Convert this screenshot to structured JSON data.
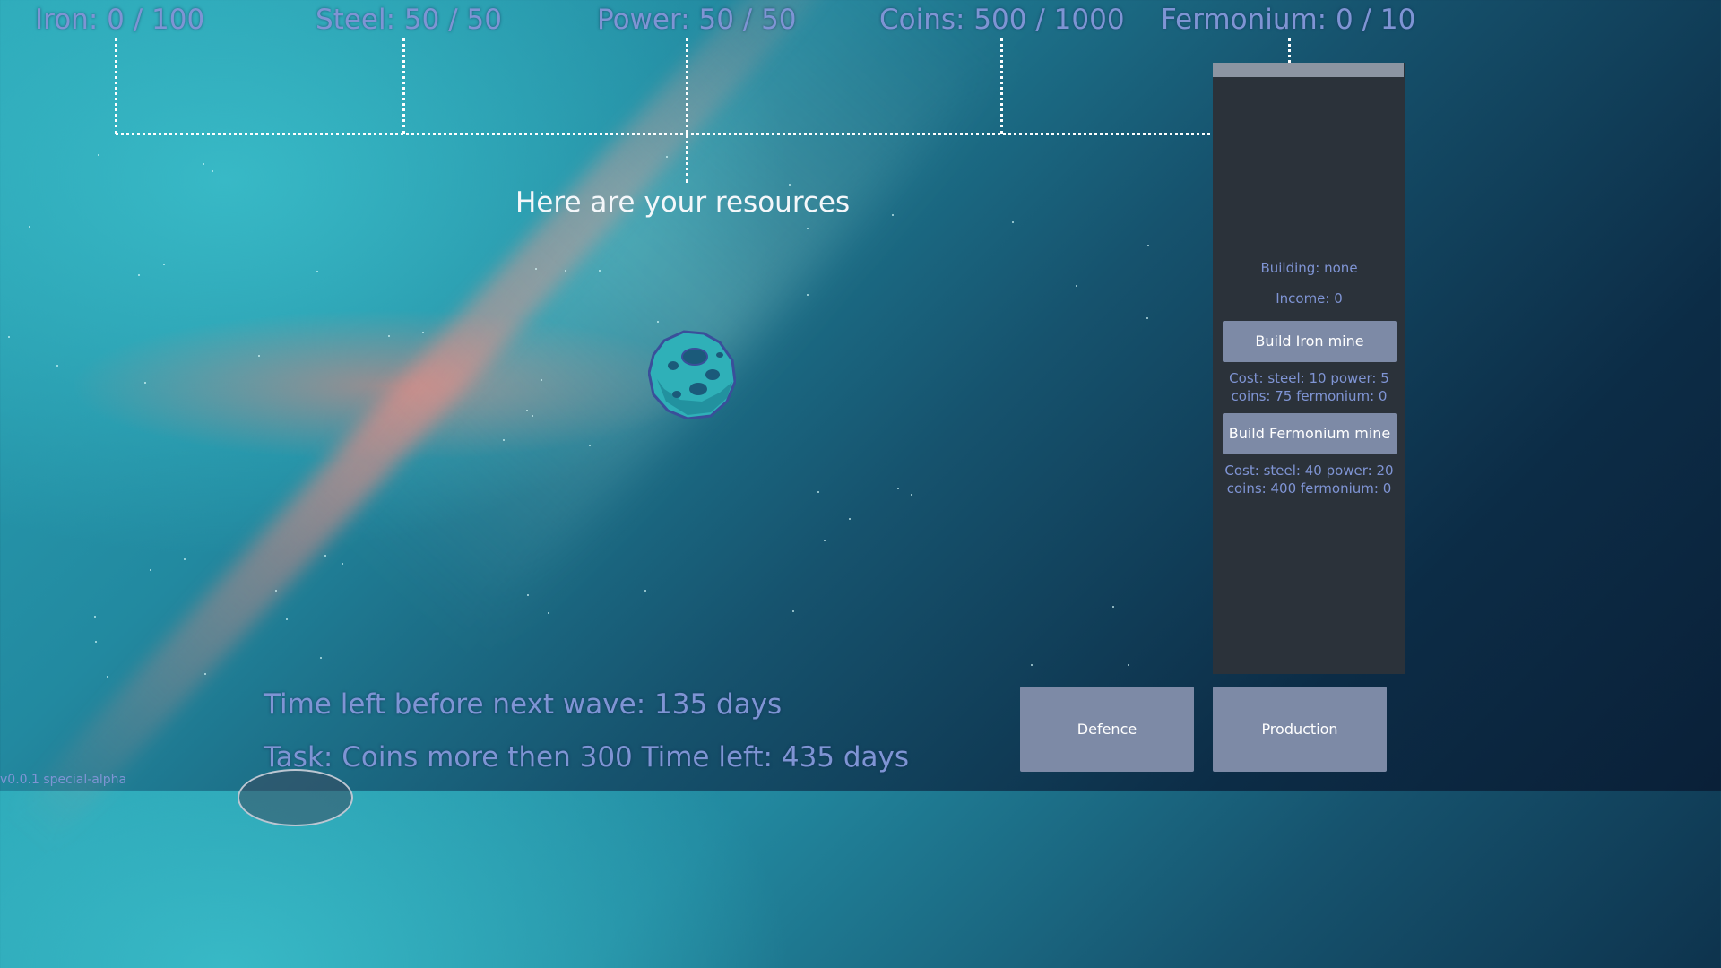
{
  "resources": {
    "iron": "Iron: 0 / 100",
    "steel": "Steel: 50 / 50",
    "power": "Power: 50 / 50",
    "coins": "Coins: 500 / 1000",
    "fermonium": "Fermonium: 0 / 10"
  },
  "tutorial_text": "Here are your resources",
  "side_panel": {
    "building": "Building: none",
    "income": "Income: 0",
    "build_iron_label": "Build Iron mine",
    "iron_cost_line1": "Cost: steel: 10 power: 5",
    "iron_cost_line2": "coins: 75 fermonium: 0",
    "build_fermonium_label": "Build Fermonium mine",
    "fermonium_cost_line1": "Cost: steel: 40 power: 20",
    "fermonium_cost_line2": "coins: 400 fermonium: 0"
  },
  "buttons": {
    "defence": "Defence",
    "production": "Production"
  },
  "status": {
    "wave_timer": "Time left before next wave: 135 days",
    "task": "Task: Coins more then 300 Time left: 435 days"
  },
  "version": "v0.0.1 special-alpha",
  "colors": {
    "hud_text": "#7f94d4",
    "button_bg": "#7d8aa6",
    "panel_bg": "#2b323a"
  }
}
